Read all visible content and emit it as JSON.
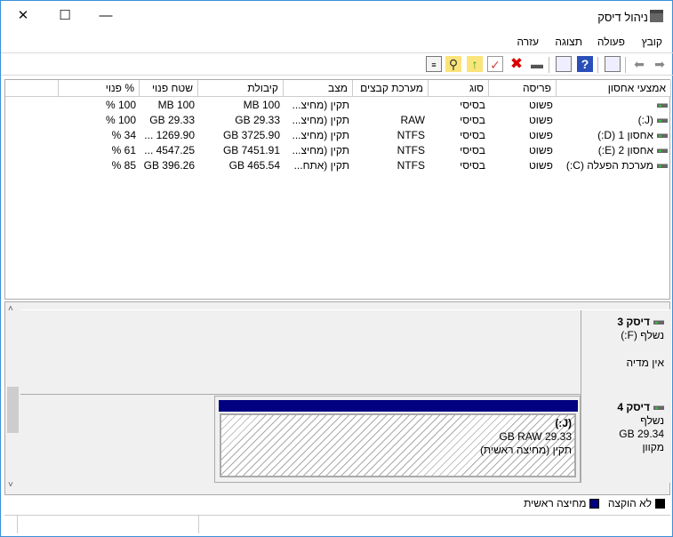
{
  "window": {
    "title": "ניהול דיסק",
    "close": "✕",
    "maximize": "☐",
    "minimize": "—"
  },
  "menu": [
    "קובץ",
    "פעולה",
    "תצוגה",
    "עזרה"
  ],
  "toolbar": [
    "forward-icon",
    "back-icon",
    "properties-icon",
    "help-icon",
    "show-pane-icon",
    "rescan-disk-icon",
    "delete-icon",
    "check-icon",
    "folder-up-icon",
    "folder-search-icon",
    "settings-icon"
  ],
  "columns": [
    "אמצעי אחסון",
    "פריסה",
    "סוג",
    "מערכת קבצים",
    "מצב",
    "קיבולת",
    "שטח פנוי",
    "% פנוי"
  ],
  "rows": [
    [
      "",
      "פשוט",
      "בסיסי",
      "",
      "תקין (מחיצ...",
      "MB 100",
      "MB 100",
      "% 100"
    ],
    [
      "(J:)",
      "פשוט",
      "בסיסי",
      "RAW",
      "תקין (מחיצ...",
      "GB 29.33",
      "GB 29.33",
      "% 100"
    ],
    [
      "אחסון 1 (D:)",
      "פשוט",
      "בסיסי",
      "NTFS",
      "תקין (מחיצ...",
      "GB 3725.90",
      "... 1269.90",
      "% 34"
    ],
    [
      "אחסון 2 (E:)",
      "פשוט",
      "בסיסי",
      "NTFS",
      "תקין (מחיצ...",
      "GB 7451.91",
      "... 4547.25",
      "% 61"
    ],
    [
      "מערכת הפעלה (C:)",
      "פשוט",
      "בסיסי",
      "NTFS",
      "תקין (אתח...",
      "GB 465.54",
      "GB 396.26",
      "% 85"
    ]
  ],
  "disks": [
    {
      "name": "דיסק 3",
      "line1": "נשלף (F:)",
      "line2": "",
      "line3": "אין מדיה"
    },
    {
      "name": "דיסק 4",
      "line1": "נשלף",
      "line2": "GB 29.34",
      "line3": "מקוון",
      "partition": {
        "name": "(J:)",
        "size": "GB RAW 29.33",
        "status": "תקין (מחיצה ראשית)"
      }
    }
  ],
  "legend": [
    {
      "label": "לא הוקצה",
      "color": "#000000"
    },
    {
      "label": "מחיצה ראשית",
      "color": "#000080"
    }
  ]
}
